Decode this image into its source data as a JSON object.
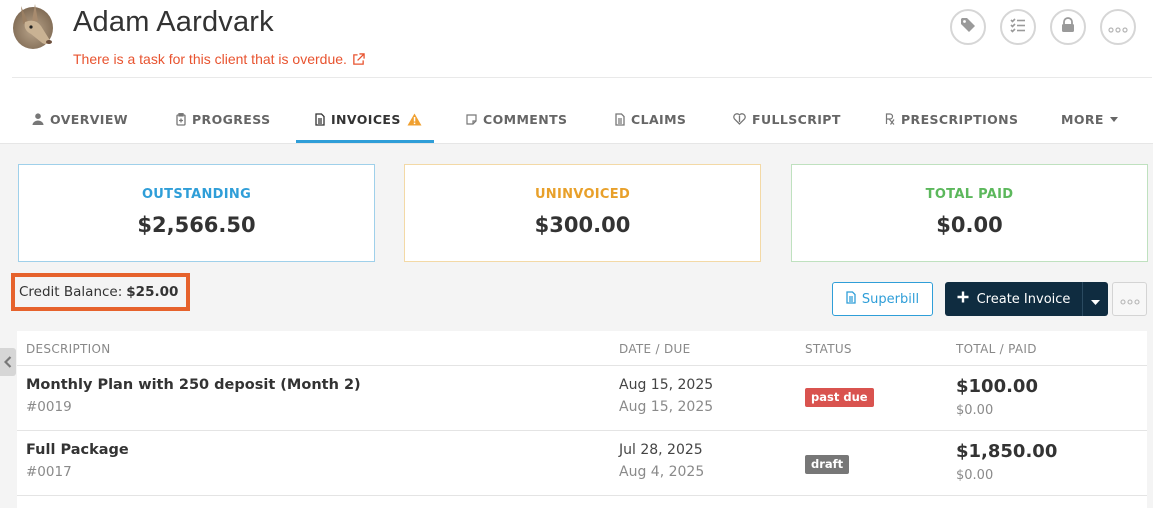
{
  "client": {
    "name": "Adam Aardvark",
    "overdue_message": "There is a task for this client that is overdue."
  },
  "header_actions": [
    "tag-icon",
    "checklist-icon",
    "lock-icon",
    "more-icon"
  ],
  "tabs": [
    {
      "label": "OVERVIEW",
      "icon": "user-icon"
    },
    {
      "label": "PROGRESS",
      "icon": "clipboard-icon"
    },
    {
      "label": "INVOICES",
      "icon": "document-icon",
      "active": true
    },
    {
      "label": "COMMENTS",
      "icon": "comment-icon"
    },
    {
      "label": "CLAIMS",
      "icon": "file-icon"
    },
    {
      "label": "FULLSCRIPT",
      "icon": "heart-icon"
    },
    {
      "label": "PRESCRIPTIONS",
      "icon": "rx-icon"
    },
    {
      "label": "MORE"
    }
  ],
  "summary": {
    "outstanding": {
      "label": "OUTSTANDING",
      "value": "$2,566.50",
      "color": "#2f9ed8"
    },
    "uninvoiced": {
      "label": "UNINVOICED",
      "value": "$300.00",
      "color": "#e8a02a"
    },
    "total_paid": {
      "label": "TOTAL PAID",
      "value": "$0.00",
      "color": "#5cb85c"
    }
  },
  "credit": {
    "label": "Credit Balance:",
    "value": "$25.00",
    "highlight_color": "#e6622c"
  },
  "actions": {
    "superbill_label": "Superbill",
    "create_invoice_label": "Create Invoice"
  },
  "table": {
    "headers": [
      "DESCRIPTION",
      "DATE / DUE",
      "STATUS",
      "TOTAL / PAID"
    ],
    "rows": [
      {
        "description": "Monthly Plan with 250 deposit (Month 2)",
        "number": "#0019",
        "date": "Aug 15, 2025",
        "due": "Aug 15, 2025",
        "status": "past due",
        "status_color": "#d9534f",
        "total": "$100.00",
        "paid": "$0.00"
      },
      {
        "description": "Full Package",
        "number": "#0017",
        "date": "Jul 28, 2025",
        "due": "Aug 4, 2025",
        "status": "draft",
        "status_color": "#777777",
        "total": "$1,850.00",
        "paid": "$0.00"
      }
    ]
  }
}
